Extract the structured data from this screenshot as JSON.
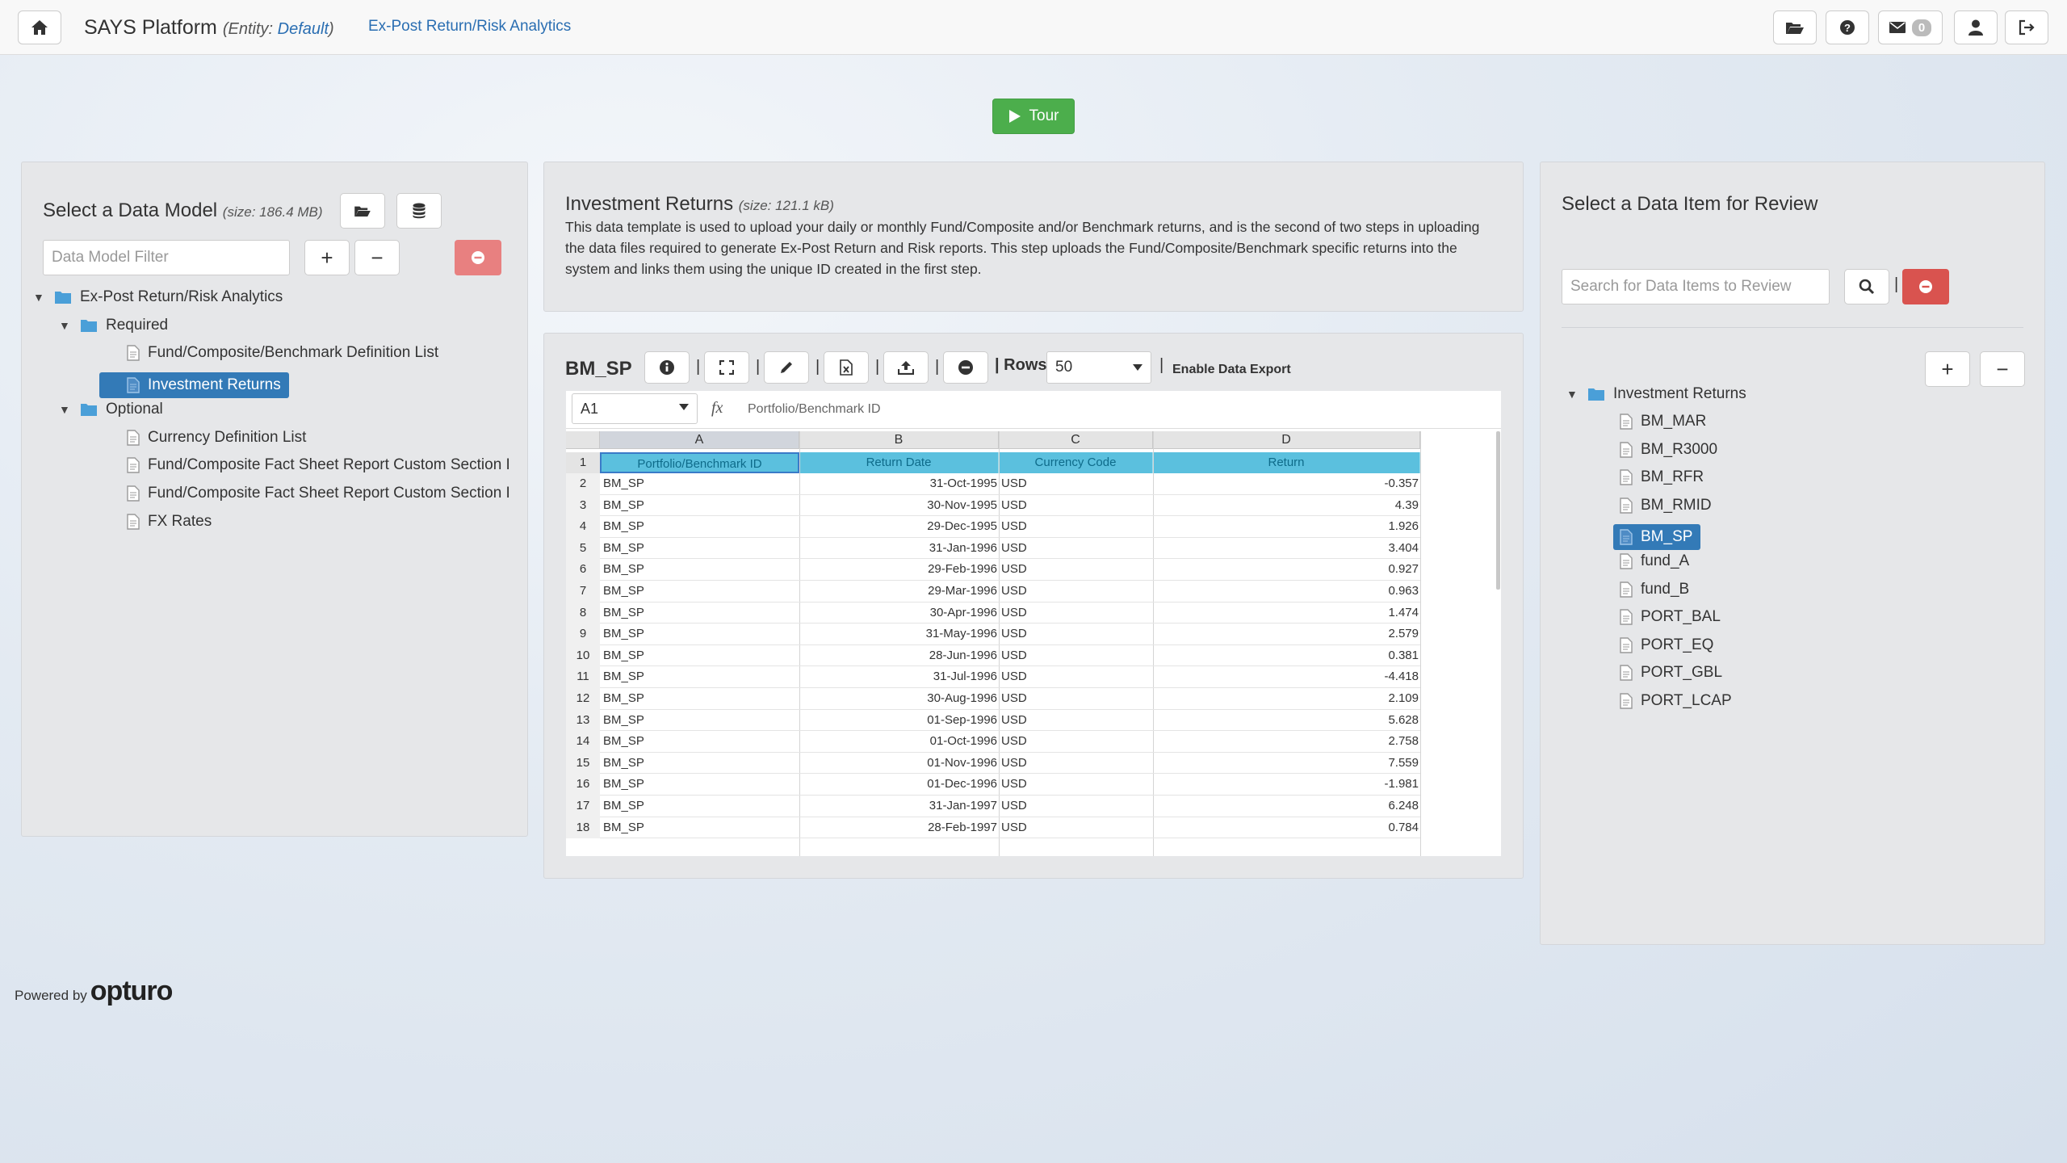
{
  "header": {
    "brand": "SAYS Platform",
    "entity_prefix": "(Entity: ",
    "entity_value": "Default",
    "entity_suffix": ")",
    "nav_link": "Ex-Post Return/Risk Analytics",
    "message_count": "0"
  },
  "tour": {
    "label": "Tour"
  },
  "left_panel": {
    "title": "Select a Data Model",
    "size": "(size: 186.4 MB)",
    "filter_placeholder": "Data Model Filter",
    "tree": [
      {
        "label": "Ex-Post Return/Risk Analytics",
        "type": "folder",
        "level": 0
      },
      {
        "label": "Required",
        "type": "folder",
        "level": 1
      },
      {
        "label": "Fund/Composite/Benchmark Definition List",
        "type": "file",
        "level": 2
      },
      {
        "label": "Investment Returns",
        "type": "file",
        "level": 2,
        "selected": true
      },
      {
        "label": "Optional",
        "type": "folder",
        "level": 1
      },
      {
        "label": "Currency Definition List",
        "type": "file",
        "level": 2
      },
      {
        "label": "Fund/Composite Fact Sheet Report Custom Section I",
        "type": "file",
        "level": 2
      },
      {
        "label": "Fund/Composite Fact Sheet Report Custom Section I",
        "type": "file",
        "level": 2
      },
      {
        "label": "FX Rates",
        "type": "file",
        "level": 2
      }
    ]
  },
  "info_panel": {
    "title": "Investment Returns",
    "size": "(size: 121.1 kB)",
    "description": "This data template is used to upload your daily or monthly Fund/Composite and/or Benchmark returns, and is the second of two steps in uploading the data files required to generate Ex-Post Return and Risk reports. This step uploads the Fund/Composite/Benchmark specific returns into the system and links them using the unique ID created in the first step."
  },
  "sheet": {
    "name": "BM_SP",
    "rows_label": "Rows:",
    "rows_value": "50",
    "export_label": "Enable Data Export",
    "cell_ref": "A1",
    "fx_label": "fx",
    "formula_value": "Portfolio/Benchmark ID",
    "columns": [
      "A",
      "B",
      "C",
      "D"
    ],
    "headers": [
      "Portfolio/Benchmark ID",
      "Return Date",
      "Currency Code",
      "Return"
    ],
    "rows": [
      [
        "BM_SP",
        "31-Oct-1995",
        "USD",
        "-0.357"
      ],
      [
        "BM_SP",
        "30-Nov-1995",
        "USD",
        "4.39"
      ],
      [
        "BM_SP",
        "29-Dec-1995",
        "USD",
        "1.926"
      ],
      [
        "BM_SP",
        "31-Jan-1996",
        "USD",
        "3.404"
      ],
      [
        "BM_SP",
        "29-Feb-1996",
        "USD",
        "0.927"
      ],
      [
        "BM_SP",
        "29-Mar-1996",
        "USD",
        "0.963"
      ],
      [
        "BM_SP",
        "30-Apr-1996",
        "USD",
        "1.474"
      ],
      [
        "BM_SP",
        "31-May-1996",
        "USD",
        "2.579"
      ],
      [
        "BM_SP",
        "28-Jun-1996",
        "USD",
        "0.381"
      ],
      [
        "BM_SP",
        "31-Jul-1996",
        "USD",
        "-4.418"
      ],
      [
        "BM_SP",
        "30-Aug-1996",
        "USD",
        "2.109"
      ],
      [
        "BM_SP",
        "01-Sep-1996",
        "USD",
        "5.628"
      ],
      [
        "BM_SP",
        "01-Oct-1996",
        "USD",
        "2.758"
      ],
      [
        "BM_SP",
        "01-Nov-1996",
        "USD",
        "7.559"
      ],
      [
        "BM_SP",
        "01-Dec-1996",
        "USD",
        "-1.981"
      ],
      [
        "BM_SP",
        "31-Jan-1997",
        "USD",
        "6.248"
      ],
      [
        "BM_SP",
        "28-Feb-1997",
        "USD",
        "0.784"
      ]
    ]
  },
  "right_panel": {
    "title": "Select a Data Item for Review",
    "search_placeholder": "Search for Data Items to Review",
    "root": "Investment Returns",
    "items": [
      "BM_MAR",
      "BM_R3000",
      "BM_RFR",
      "BM_RMID",
      "BM_SP",
      "fund_A",
      "fund_B",
      "PORT_BAL",
      "PORT_EQ",
      "PORT_GBL",
      "PORT_LCAP"
    ],
    "selected": "BM_SP"
  },
  "footer": {
    "powered_by": "Powered by",
    "logo": "opturo"
  }
}
